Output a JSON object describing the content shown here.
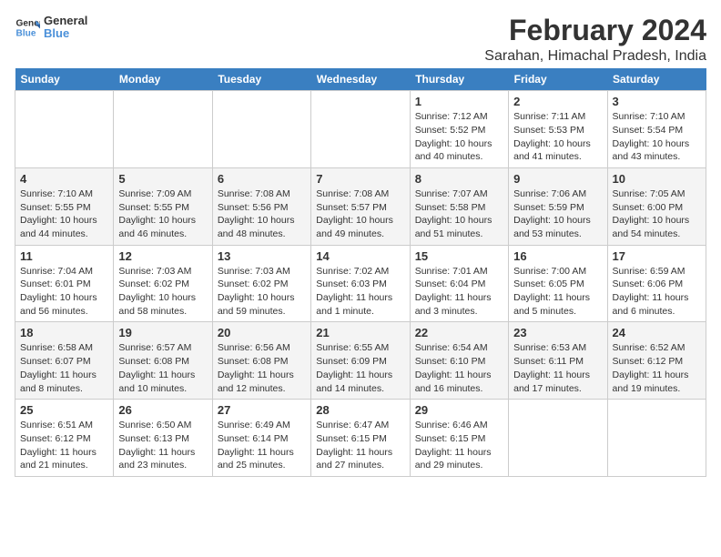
{
  "header": {
    "logo_general": "General",
    "logo_blue": "Blue",
    "title": "February 2024",
    "subtitle": "Sarahan, Himachal Pradesh, India"
  },
  "days": [
    "Sunday",
    "Monday",
    "Tuesday",
    "Wednesday",
    "Thursday",
    "Friday",
    "Saturday"
  ],
  "weeks": [
    [
      {
        "date": "",
        "text": ""
      },
      {
        "date": "",
        "text": ""
      },
      {
        "date": "",
        "text": ""
      },
      {
        "date": "",
        "text": ""
      },
      {
        "date": "1",
        "text": "Sunrise: 7:12 AM\nSunset: 5:52 PM\nDaylight: 10 hours and 40 minutes."
      },
      {
        "date": "2",
        "text": "Sunrise: 7:11 AM\nSunset: 5:53 PM\nDaylight: 10 hours and 41 minutes."
      },
      {
        "date": "3",
        "text": "Sunrise: 7:10 AM\nSunset: 5:54 PM\nDaylight: 10 hours and 43 minutes."
      }
    ],
    [
      {
        "date": "4",
        "text": "Sunrise: 7:10 AM\nSunset: 5:55 PM\nDaylight: 10 hours and 44 minutes."
      },
      {
        "date": "5",
        "text": "Sunrise: 7:09 AM\nSunset: 5:55 PM\nDaylight: 10 hours and 46 minutes."
      },
      {
        "date": "6",
        "text": "Sunrise: 7:08 AM\nSunset: 5:56 PM\nDaylight: 10 hours and 48 minutes."
      },
      {
        "date": "7",
        "text": "Sunrise: 7:08 AM\nSunset: 5:57 PM\nDaylight: 10 hours and 49 minutes."
      },
      {
        "date": "8",
        "text": "Sunrise: 7:07 AM\nSunset: 5:58 PM\nDaylight: 10 hours and 51 minutes."
      },
      {
        "date": "9",
        "text": "Sunrise: 7:06 AM\nSunset: 5:59 PM\nDaylight: 10 hours and 53 minutes."
      },
      {
        "date": "10",
        "text": "Sunrise: 7:05 AM\nSunset: 6:00 PM\nDaylight: 10 hours and 54 minutes."
      }
    ],
    [
      {
        "date": "11",
        "text": "Sunrise: 7:04 AM\nSunset: 6:01 PM\nDaylight: 10 hours and 56 minutes."
      },
      {
        "date": "12",
        "text": "Sunrise: 7:03 AM\nSunset: 6:02 PM\nDaylight: 10 hours and 58 minutes."
      },
      {
        "date": "13",
        "text": "Sunrise: 7:03 AM\nSunset: 6:02 PM\nDaylight: 10 hours and 59 minutes."
      },
      {
        "date": "14",
        "text": "Sunrise: 7:02 AM\nSunset: 6:03 PM\nDaylight: 11 hours and 1 minute."
      },
      {
        "date": "15",
        "text": "Sunrise: 7:01 AM\nSunset: 6:04 PM\nDaylight: 11 hours and 3 minutes."
      },
      {
        "date": "16",
        "text": "Sunrise: 7:00 AM\nSunset: 6:05 PM\nDaylight: 11 hours and 5 minutes."
      },
      {
        "date": "17",
        "text": "Sunrise: 6:59 AM\nSunset: 6:06 PM\nDaylight: 11 hours and 6 minutes."
      }
    ],
    [
      {
        "date": "18",
        "text": "Sunrise: 6:58 AM\nSunset: 6:07 PM\nDaylight: 11 hours and 8 minutes."
      },
      {
        "date": "19",
        "text": "Sunrise: 6:57 AM\nSunset: 6:08 PM\nDaylight: 11 hours and 10 minutes."
      },
      {
        "date": "20",
        "text": "Sunrise: 6:56 AM\nSunset: 6:08 PM\nDaylight: 11 hours and 12 minutes."
      },
      {
        "date": "21",
        "text": "Sunrise: 6:55 AM\nSunset: 6:09 PM\nDaylight: 11 hours and 14 minutes."
      },
      {
        "date": "22",
        "text": "Sunrise: 6:54 AM\nSunset: 6:10 PM\nDaylight: 11 hours and 16 minutes."
      },
      {
        "date": "23",
        "text": "Sunrise: 6:53 AM\nSunset: 6:11 PM\nDaylight: 11 hours and 17 minutes."
      },
      {
        "date": "24",
        "text": "Sunrise: 6:52 AM\nSunset: 6:12 PM\nDaylight: 11 hours and 19 minutes."
      }
    ],
    [
      {
        "date": "25",
        "text": "Sunrise: 6:51 AM\nSunset: 6:12 PM\nDaylight: 11 hours and 21 minutes."
      },
      {
        "date": "26",
        "text": "Sunrise: 6:50 AM\nSunset: 6:13 PM\nDaylight: 11 hours and 23 minutes."
      },
      {
        "date": "27",
        "text": "Sunrise: 6:49 AM\nSunset: 6:14 PM\nDaylight: 11 hours and 25 minutes."
      },
      {
        "date": "28",
        "text": "Sunrise: 6:47 AM\nSunset: 6:15 PM\nDaylight: 11 hours and 27 minutes."
      },
      {
        "date": "29",
        "text": "Sunrise: 6:46 AM\nSunset: 6:15 PM\nDaylight: 11 hours and 29 minutes."
      },
      {
        "date": "",
        "text": ""
      },
      {
        "date": "",
        "text": ""
      }
    ]
  ]
}
